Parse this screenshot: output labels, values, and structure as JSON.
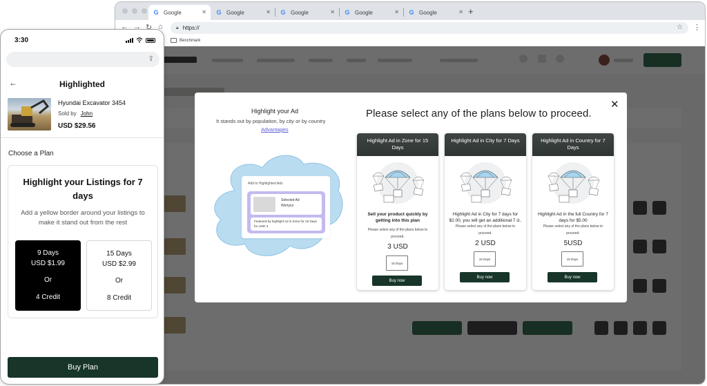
{
  "browser": {
    "tabs": [
      {
        "label": "Google",
        "favicon": "google-g-icon"
      },
      {
        "label": "Google",
        "favicon": "google-g-icon"
      },
      {
        "label": "Google",
        "favicon": "google-g-icon"
      },
      {
        "label": "Google",
        "favicon": "google-g-icon"
      },
      {
        "label": "Google",
        "favicon": "google-g-icon"
      }
    ],
    "url": "https://",
    "bookmark": "Benchmark"
  },
  "modal": {
    "highlight_title": "Highlight your Ad",
    "highlight_subtitle": "It stands out by population, by city or by country",
    "advantages_link": "Advantages",
    "heading": "Please select any of the plans below to proceed.",
    "illustration": {
      "add_to": "Add to Highlighted Ads",
      "selected_line1": "Selected Ad",
      "selected_line2": "Wertyiui",
      "featured": "Featured by highlight Ad in Zone for 15 Days for USD 3"
    },
    "plans": [
      {
        "title": "Highlight Ad in Zone for 15 Days",
        "description": "Sell your product quickly by getting into this plan",
        "note": "Please select any of the plans below to proceed.",
        "price": "3 USD",
        "days": "15 Days",
        "buy": "Buy now"
      },
      {
        "title": "Highlight Ad in City for 7 Days",
        "description": "Highlight Ad in City for 7 days for $2.00, you will get an additional 7 d..",
        "note": "Please select any of the plans below to proceed.",
        "price": "2 USD",
        "days": "15 Days",
        "buy": "Buy now"
      },
      {
        "title": "Highlight Ad in Country for 7 Days",
        "description": "Highlight Ad in the full Country for 7 days for $5.00",
        "note": "Please select any of the plans below to proceed.",
        "price": "5USD",
        "days": "15 Days",
        "buy": "Buy now"
      }
    ]
  },
  "phone": {
    "time": "3:30",
    "title": "Highlighted",
    "product": {
      "name": "Hyundai Excavator 3454",
      "sold_by_label": "Sold by",
      "seller": "John",
      "price": "USD $29.56"
    },
    "choose_plan": "Choose a Plan",
    "card": {
      "title": "Highlight your Listings for 7 days",
      "subtitle": "Add a yellow border around your listings to make it stand out from the rest",
      "options": [
        {
          "days": "9 Days",
          "price": "USD $1.99",
          "or": "Or",
          "credit": "4 Credit",
          "selected": true
        },
        {
          "days": "15 Days",
          "price": "USD $2.99",
          "or": "Or",
          "credit": "8 Credit",
          "selected": false
        }
      ]
    },
    "buy_button": "Buy Plan"
  },
  "colors": {
    "primary_dark_green": "#173528",
    "plan_header": "#3f4543",
    "link_purple": "#5b5bd6",
    "illustration_purple": "#c5b9f0",
    "illustration_blue": "#a9d4ee"
  }
}
